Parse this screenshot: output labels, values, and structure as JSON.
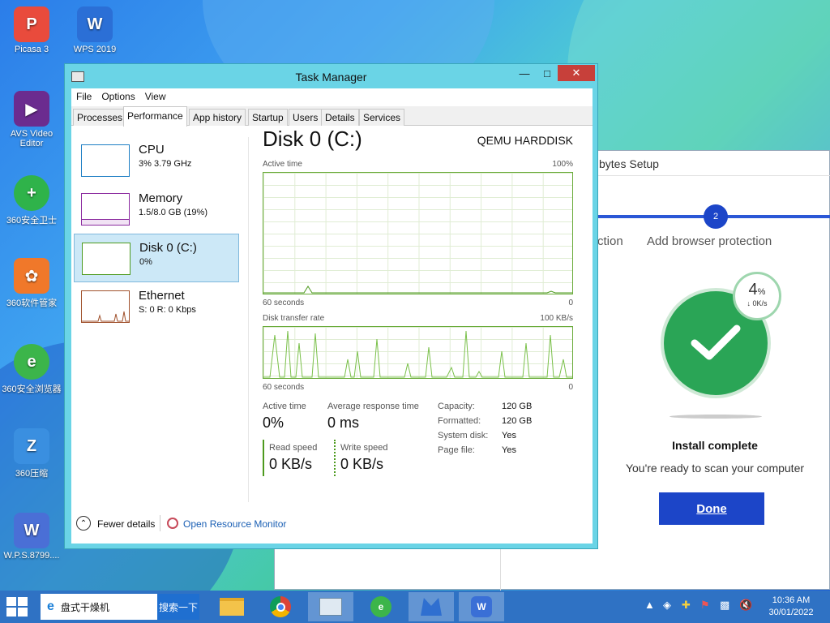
{
  "desktop": {
    "icons": [
      {
        "label": "Picasa 3",
        "color": "#e94b3c",
        "glyph": "P"
      },
      {
        "label": "WPS 2019",
        "color": "#2b6fd6",
        "glyph": "W"
      },
      {
        "label": "AVS Video Editor",
        "color": "#6b2c8f",
        "glyph": "▶"
      },
      {
        "label": "360安全卫士",
        "color": "#2fb34a",
        "glyph": "+"
      },
      {
        "label": "360软件管家",
        "color": "#f0782a",
        "glyph": "✿"
      },
      {
        "label": "360安全浏览器",
        "color": "#3cb54a",
        "glyph": "e"
      },
      {
        "label": "360压缩",
        "color": "#3a8fe0",
        "glyph": "Z"
      },
      {
        "label": "W.P.S.8799....",
        "color": "#4a6fd6",
        "glyph": "W"
      }
    ]
  },
  "malwarebytes": {
    "title": "bytes Setup",
    "step_left": "ction",
    "step_number": "2",
    "step_label": "Add browser protection",
    "speed_pct": "4",
    "speed_pct_unit": "%",
    "speed_rate": "↓ 0K/s",
    "heading": "Install complete",
    "subtext": "You're ready to scan your computer",
    "done_label": "Done",
    "accent": "#1c45c8",
    "success": "#2aa556"
  },
  "taskmgr": {
    "title": "Task Manager",
    "menu": [
      "File",
      "Options",
      "View"
    ],
    "tabs": [
      "Processes",
      "Performance",
      "App history",
      "Startup",
      "Users",
      "Details",
      "Services"
    ],
    "active_tab": "Performance",
    "resources": [
      {
        "name": "CPU",
        "detail": "3% 3.79 GHz",
        "color": "#1e7fc4"
      },
      {
        "name": "Memory",
        "detail": "1.5/8.0 GB (19%)",
        "color": "#8b2a9f"
      },
      {
        "name": "Disk 0 (C:)",
        "detail": "0%",
        "color": "#4d9a1e"
      },
      {
        "name": "Ethernet",
        "detail": "S: 0 R: 0 Kbps",
        "color": "#a0522d"
      }
    ],
    "disk": {
      "title": "Disk 0 (C:)",
      "model": "QEMU HARDDISK",
      "graph1_label": "Active time",
      "graph1_max": "100%",
      "graph1_time": "60 seconds",
      "graph1_min": "0",
      "graph2_label": "Disk transfer rate",
      "graph2_max": "100 KB/s",
      "graph2_time": "60 seconds",
      "graph2_min": "0",
      "active_time_label": "Active time",
      "active_time_value": "0%",
      "avg_response_label": "Average response time",
      "avg_response_value": "0 ms",
      "read_speed_label": "Read speed",
      "read_speed_value": "0 KB/s",
      "write_speed_label": "Write speed",
      "write_speed_value": "0 KB/s",
      "capacity_label": "Capacity:",
      "capacity_value": "120 GB",
      "formatted_label": "Formatted:",
      "formatted_value": "120 GB",
      "system_disk_label": "System disk:",
      "system_disk_value": "Yes",
      "page_file_label": "Page file:",
      "page_file_value": "Yes"
    },
    "fewer_details": "Fewer details",
    "open_resource_monitor": "Open Resource Monitor"
  },
  "taskbar": {
    "search_text": "盘式干燥机",
    "search_button": "搜索一下",
    "time": "10:36 AM",
    "date": "30/01/2022"
  }
}
